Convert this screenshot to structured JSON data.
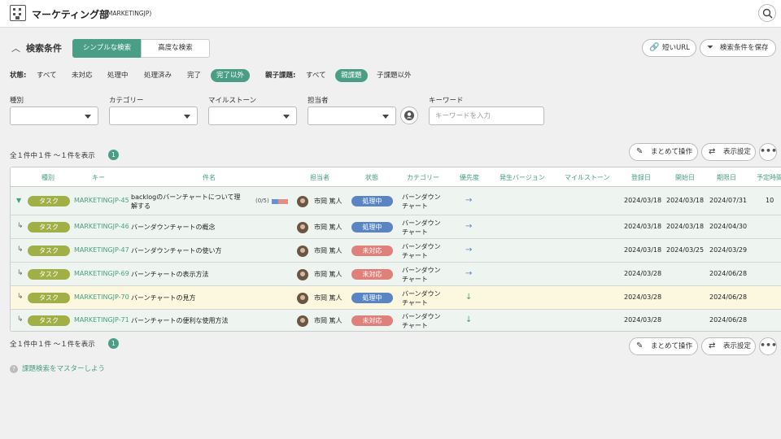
{
  "header": {
    "project_name": "マーケティング部",
    "project_key": "(MARKETINGJP)",
    "icons": {
      "project": "building-icon",
      "search": "search-icon"
    }
  },
  "filter": {
    "title": "検索条件",
    "tabs": [
      {
        "label": "シンプルな検索",
        "active": true
      },
      {
        "label": "高度な検索",
        "active": false
      }
    ],
    "short_url": "短いURL",
    "save_condition": "検索条件を保存",
    "status_label": "状態:",
    "status_options": [
      {
        "label": "すべて",
        "active": false
      },
      {
        "label": "未対応",
        "active": false
      },
      {
        "label": "処理中",
        "active": false
      },
      {
        "label": "処理済み",
        "active": false
      },
      {
        "label": "完了",
        "active": false
      },
      {
        "label": "完了以外",
        "active": true
      }
    ],
    "parent_label": "親子課題:",
    "parent_options": [
      {
        "label": "すべて",
        "active": false
      },
      {
        "label": "親課題",
        "active": true
      },
      {
        "label": "子課題以外",
        "active": false
      }
    ],
    "fields": {
      "type": "種別",
      "category": "カテゴリー",
      "milestone": "マイルストーン",
      "assignee": "担当者",
      "keyword": "キーワード"
    },
    "keyword_placeholder": "キーワードを入力"
  },
  "results": {
    "count_text": "全１件中１件 〜１件を表示",
    "page": "1",
    "bulk_edit": "まとめて操作",
    "display_settings": "表示設定",
    "more": "•••"
  },
  "table": {
    "columns": [
      "種別",
      "キー",
      "件名",
      "担当者",
      "状態",
      "カテゴリー",
      "優先度",
      "発生バージョン",
      "マイルストーン",
      "登録日",
      "開始日",
      "期限日",
      "予定時間"
    ],
    "rows": [
      {
        "parent": true,
        "type": "タスク",
        "key": "MARKETINGJP-45",
        "subject": "backlogのバーンチャートについて理解する",
        "progress": "(0/5)",
        "progress_fraction": 0.4,
        "assignee": "市岡 篤人",
        "status": "処理中",
        "status_color": "#5b84c4",
        "category": "バーンダウンチャート",
        "priority": "→",
        "priority_color": "#5b84c4",
        "registered": "2024/03/18",
        "start": "2024/03/18",
        "due": "2024/07/31",
        "estimate": "10",
        "highlight": false
      },
      {
        "parent": false,
        "type": "タスク",
        "key": "MARKETINGJP-46",
        "subject": "バーンダウンチャートの概念",
        "assignee": "市岡 篤人",
        "status": "処理中",
        "status_color": "#5b84c4",
        "category": "バーンダウンチャート",
        "priority": "→",
        "priority_color": "#5b84c4",
        "registered": "2024/03/18",
        "start": "2024/03/18",
        "due": "2024/04/30",
        "estimate": "",
        "highlight": false
      },
      {
        "parent": false,
        "type": "タスク",
        "key": "MARKETINGJP-47",
        "subject": "バーンダウンチャートの使い方",
        "assignee": "市岡 篤人",
        "status": "未対応",
        "status_color": "#e0807b",
        "category": "バーンダウンチャート",
        "priority": "→",
        "priority_color": "#5b84c4",
        "registered": "2024/03/18",
        "start": "2024/03/25",
        "due": "2024/03/29",
        "estimate": "",
        "highlight": false
      },
      {
        "parent": false,
        "type": "タスク",
        "key": "MARKETINGJP-69",
        "subject": "バーンチャートの表示方法",
        "assignee": "市岡 篤人",
        "status": "未対応",
        "status_color": "#e0807b",
        "category": "バーンダウンチャート",
        "priority": "→",
        "priority_color": "#5b84c4",
        "registered": "2024/03/28",
        "start": "",
        "due": "2024/06/28",
        "estimate": "",
        "highlight": false
      },
      {
        "parent": false,
        "type": "タスク",
        "key": "MARKETINGJP-70",
        "subject": "バーンチャートの見方",
        "assignee": "市岡 篤人",
        "status": "処理中",
        "status_color": "#5b84c4",
        "category": "バーンダウンチャート",
        "priority": "↓",
        "priority_color": "#4a9e85",
        "registered": "2024/03/28",
        "start": "",
        "due": "2024/06/28",
        "estimate": "",
        "highlight": true
      },
      {
        "parent": false,
        "type": "タスク",
        "key": "MARKETINGJP-71",
        "subject": "バーンチャートの便利な使用方法",
        "assignee": "市岡 篤人",
        "status": "未対応",
        "status_color": "#e0807b",
        "category": "バーンダウンチャート",
        "priority": "↓",
        "priority_color": "#4a9e85",
        "registered": "2024/03/28",
        "start": "",
        "due": "2024/06/28",
        "estimate": "",
        "highlight": false
      }
    ]
  },
  "help_link": "課題検索をマスターしよう"
}
